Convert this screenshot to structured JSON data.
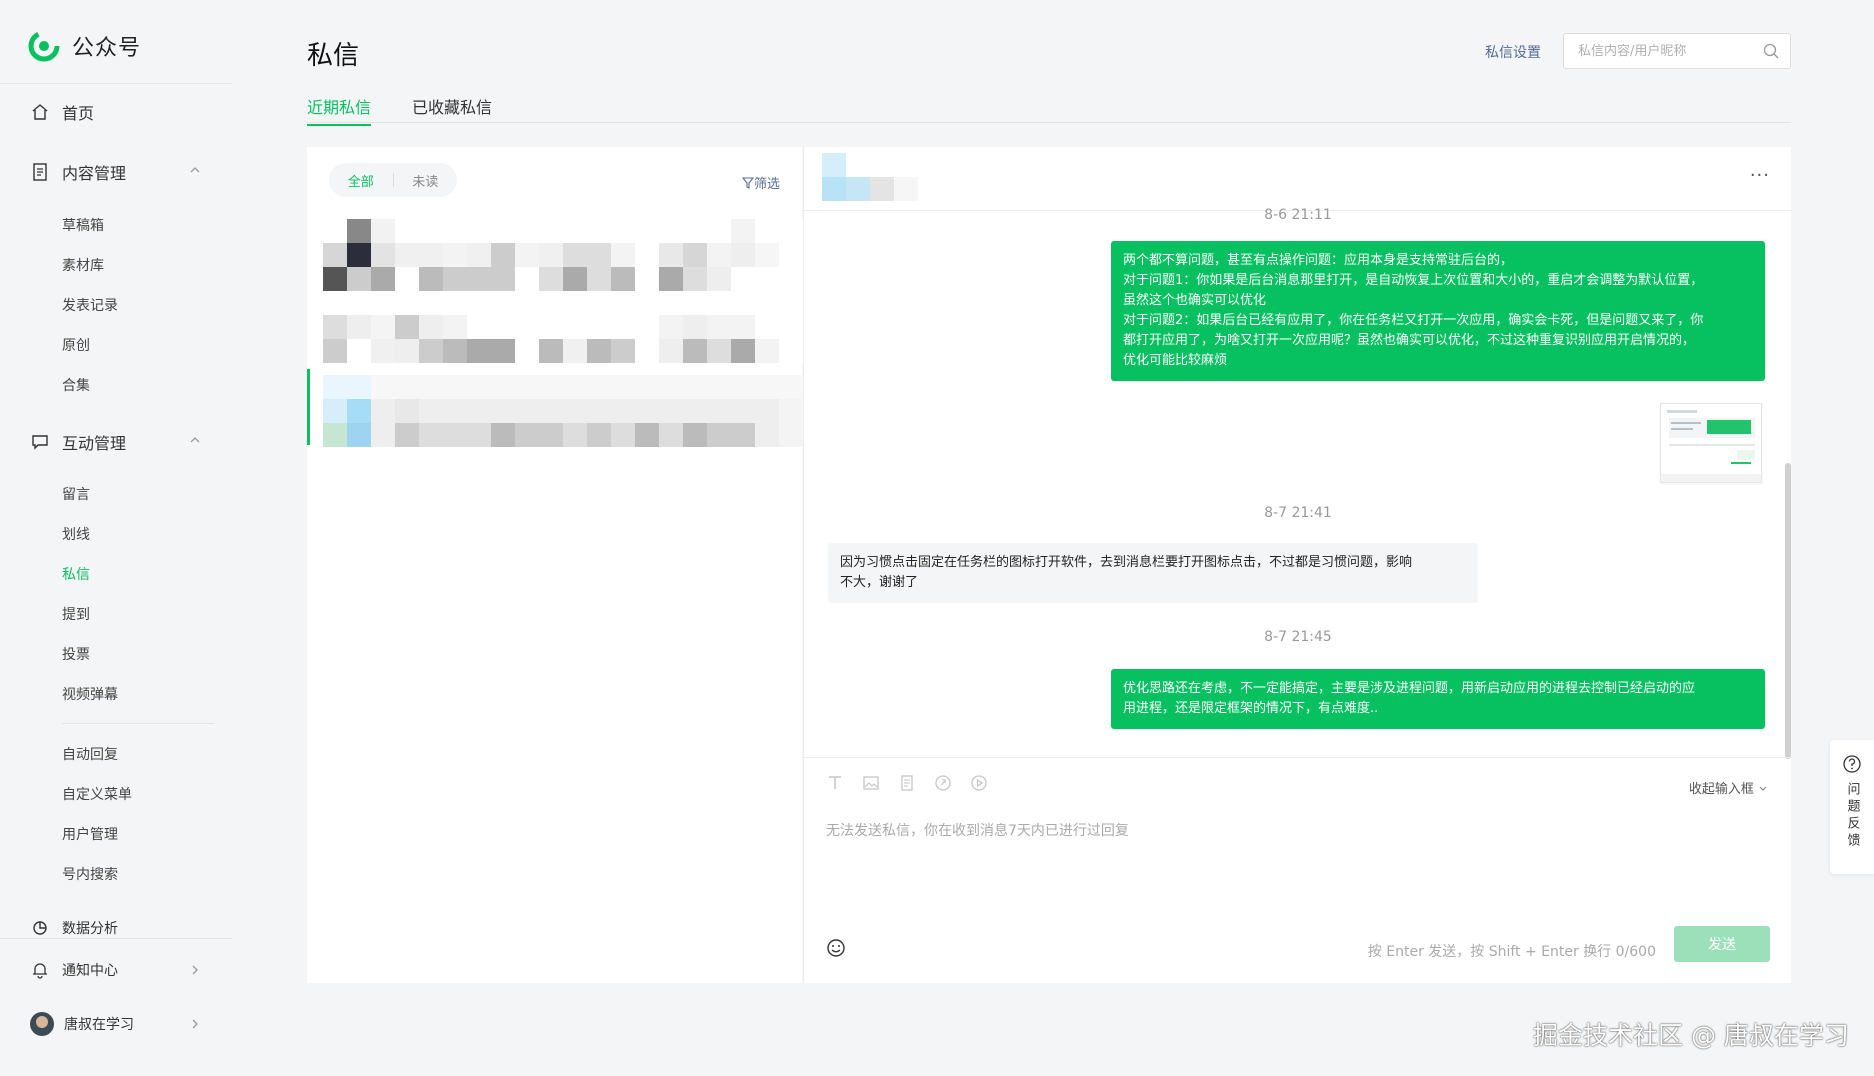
{
  "app": {
    "name": "公众号",
    "brand_color": "#07c160"
  },
  "sidebar": {
    "home": "首页",
    "content_group": {
      "label": "内容管理",
      "items": [
        "草稿箱",
        "素材库",
        "发表记录",
        "原创",
        "合集"
      ]
    },
    "interaction_group": {
      "label": "互动管理",
      "items": [
        "留言",
        "划线",
        "私信",
        "提到",
        "投票",
        "视频弹幕"
      ],
      "active": "私信"
    },
    "more_items": [
      "自动回复",
      "自定义菜单",
      "用户管理",
      "号内搜索"
    ],
    "data_analysis": "数据分析",
    "notifications": "通知中心",
    "account": "唐叔在学习"
  },
  "header": {
    "title": "私信",
    "settings_link": "私信设置",
    "search_placeholder": "私信内容/用户昵称"
  },
  "tabs": [
    {
      "label": "近期私信",
      "active": true
    },
    {
      "label": "已收藏私信",
      "active": false
    }
  ],
  "list": {
    "filter_all": "全部",
    "filter_unread": "未读",
    "filter_button": "筛选"
  },
  "chat": {
    "more": "···",
    "messages": [
      {
        "type": "time",
        "text": "8-6 21:11"
      },
      {
        "type": "out",
        "lines": [
          "两个都不算问题，甚至有点操作问题：应用本身是支持常驻后台的，",
          "对于问题1：你如果是后台消息那里打开，是自动恢复上次位置和大小的，重启才会调整为默认位置，",
          "虽然这个也确实可以优化",
          "对于问题2：如果后台已经有应用了，你在任务栏又打开一次应用，确实会卡死，但是问题又来了，你",
          "都打开应用了，为啥又打开一次应用呢？虽然也确实可以优化，不过这种重复识别应用开启情况的，",
          "优化可能比较麻烦"
        ]
      },
      {
        "type": "image"
      },
      {
        "type": "time",
        "text": "8-7 21:41"
      },
      {
        "type": "in",
        "lines": [
          "因为习惯点击固定在任务栏的图标打开软件，去到消息栏要打开图标点击，不过都是习惯问题，影响",
          "不大，谢谢了"
        ]
      },
      {
        "type": "time",
        "text": "8-7 21:45"
      },
      {
        "type": "out",
        "lines": [
          "优化思路还在考虑，不一定能搞定，主要是涉及进程问题，用新启动应用的进程去控制已经启动的应",
          "用进程，还是限定框架的情况下，有点难度.."
        ]
      }
    ],
    "composer": {
      "collapse": "收起输入框",
      "hint": "无法发送私信，你在收到消息7天内已进行过回复",
      "send_hint": "按 Enter 发送，按 Shift + Enter 换行  0/600",
      "send": "发送"
    }
  },
  "feedback": "问题反馈",
  "watermark": "掘金技术社区 @ 唐叔在学习",
  "icons": [
    "logo-icon",
    "home-icon",
    "document-icon",
    "chat-icon",
    "chart-icon",
    "bell-icon",
    "search-icon",
    "filter-icon",
    "text-icon",
    "image-icon",
    "file-icon",
    "link-icon",
    "video-icon",
    "emoji-icon",
    "question-icon"
  ]
}
